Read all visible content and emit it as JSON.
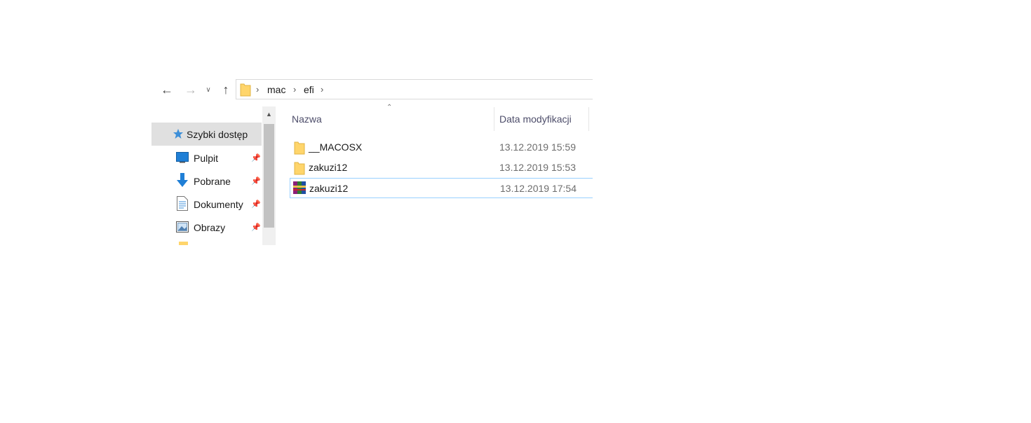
{
  "navigation": {
    "back_icon": "arrow-left-icon",
    "forward_icon": "arrow-right-icon",
    "history_icon": "chevron-down-icon",
    "up_icon": "arrow-up-icon"
  },
  "address_bar": {
    "icon": "folder-icon",
    "path": [
      "mac",
      "efi"
    ],
    "separator": "›"
  },
  "sidebar": {
    "items": [
      {
        "label": "Szybki dostęp",
        "icon": "star-icon",
        "selected": true,
        "pinned": false
      },
      {
        "label": "Pulpit",
        "icon": "desktop-icon",
        "pinned": true
      },
      {
        "label": "Pobrane",
        "icon": "download-arrow-icon",
        "pinned": true
      },
      {
        "label": "Dokumenty",
        "icon": "document-icon",
        "pinned": true
      },
      {
        "label": "Obrazy",
        "icon": "picture-icon",
        "pinned": true
      }
    ],
    "pin_icon": "pin-icon"
  },
  "file_list": {
    "columns": [
      "Nazwa",
      "Data modyfikacji"
    ],
    "sort_column": "Nazwa",
    "rows": [
      {
        "name": "__MACOSX",
        "modified": "13.12.2019 15:59",
        "icon": "folder-icon",
        "selected": false
      },
      {
        "name": "zakuzi12",
        "modified": "13.12.2019 15:53",
        "icon": "folder-icon",
        "selected": false
      },
      {
        "name": "zakuzi12",
        "modified": "13.12.2019 17:54",
        "icon": "winrar-archive-icon",
        "selected": true
      }
    ]
  },
  "colors": {
    "selection_border": "#99d1ff",
    "sidebar_selected": "#e0e0e0",
    "folder": "#ffd56b",
    "accent_blue": "#1f7fd6"
  }
}
